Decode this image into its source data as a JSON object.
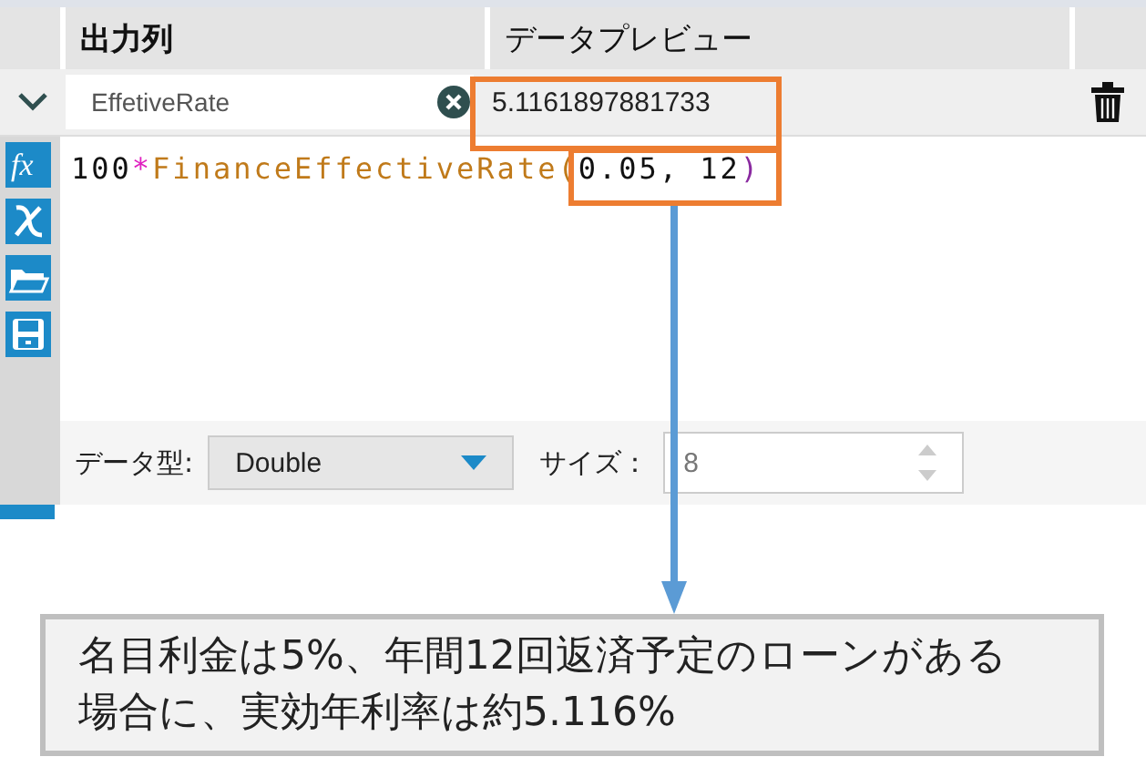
{
  "columns": [
    {
      "label": "出力列"
    },
    {
      "label": "データプレビュー"
    }
  ],
  "field": {
    "name": "EffetiveRate",
    "expanded": true,
    "preview": "5.1161897881733"
  },
  "function_icon": "fx",
  "expression": [
    {
      "kind": "number",
      "text": "100"
    },
    {
      "kind": "operator",
      "text": "*"
    },
    {
      "kind": "function",
      "text": "FinanceEffectiveRate("
    },
    {
      "kind": "number",
      "text": "0.05, 12"
    },
    {
      "kind": "paren",
      "text": ")"
    }
  ],
  "data_type": {
    "label": "データ型:",
    "value": "Double"
  },
  "size": {
    "label": "サイズ：",
    "value": "8"
  },
  "callout": "名目利金は5%、年間12回返済予定のローンがある場合に、実効年利率は約5.116%"
}
